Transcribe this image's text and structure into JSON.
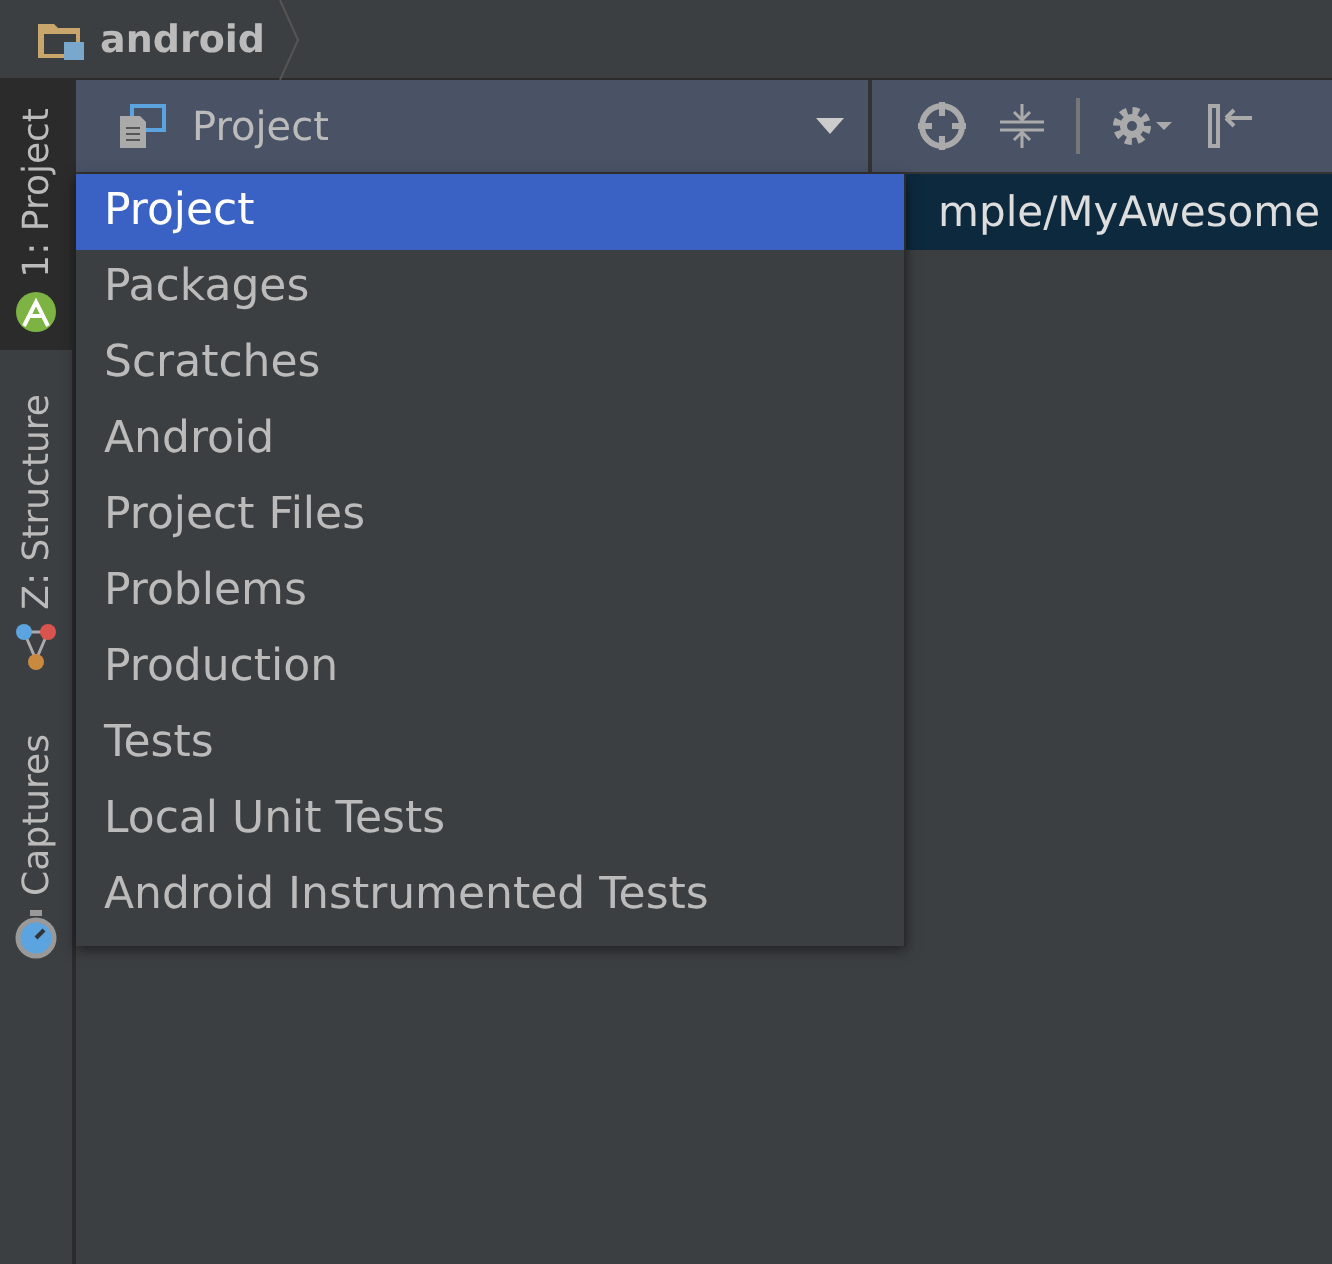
{
  "breadcrumb": {
    "label": "android"
  },
  "side_tabs": [
    {
      "label": "1: Project",
      "kind": "android",
      "selected": true
    },
    {
      "label": "Z: Structure",
      "kind": "structure",
      "selected": false
    },
    {
      "label": "Captures",
      "kind": "captures",
      "selected": false
    }
  ],
  "view_selector": {
    "value": "Project"
  },
  "tree_row": {
    "text": "mple/MyAwesome"
  },
  "menu": [
    {
      "label": "Project",
      "selected": true
    },
    {
      "label": "Packages",
      "selected": false
    },
    {
      "label": "Scratches",
      "selected": false
    },
    {
      "label": "Android",
      "selected": false
    },
    {
      "label": "Project Files",
      "selected": false
    },
    {
      "label": "Problems",
      "selected": false
    },
    {
      "label": "Production",
      "selected": false
    },
    {
      "label": "Tests",
      "selected": false
    },
    {
      "label": "Local Unit Tests",
      "selected": false
    },
    {
      "label": "Android Instrumented Tests",
      "selected": false
    }
  ]
}
